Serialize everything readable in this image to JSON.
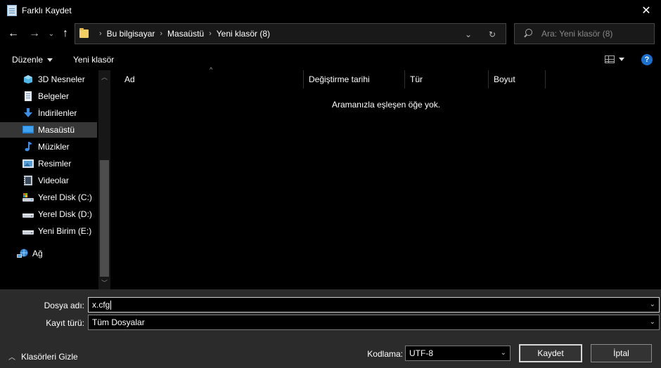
{
  "window": {
    "title": "Farklı Kaydet"
  },
  "nav": {
    "breadcrumbs": [
      "Bu bilgisayar",
      "Masaüstü",
      "Yeni klasör (8)"
    ],
    "search_placeholder": "Ara: Yeni klasör (8)"
  },
  "toolbar": {
    "organize_label": "Düzenle",
    "new_folder_label": "Yeni klasör"
  },
  "sidebar": {
    "items": [
      {
        "label": "3D Nesneler",
        "icon": "3d-objects-icon"
      },
      {
        "label": "Belgeler",
        "icon": "documents-icon"
      },
      {
        "label": "İndirilenler",
        "icon": "downloads-icon"
      },
      {
        "label": "Masaüstü",
        "icon": "desktop-icon",
        "selected": true
      },
      {
        "label": "Müzikler",
        "icon": "music-icon"
      },
      {
        "label": "Resimler",
        "icon": "pictures-icon"
      },
      {
        "label": "Videolar",
        "icon": "videos-icon"
      },
      {
        "label": "Yerel Disk (C:)",
        "icon": "system-drive-icon"
      },
      {
        "label": "Yerel Disk (D:)",
        "icon": "drive-icon"
      },
      {
        "label": "Yeni Birim (E:)",
        "icon": "drive-icon"
      },
      {
        "label": "Ağ",
        "icon": "network-icon"
      }
    ]
  },
  "file_list": {
    "columns": [
      "Ad",
      "Değiştirme tarihi",
      "Tür",
      "Boyut"
    ],
    "empty_message": "Aramanızla eşleşen öğe yok."
  },
  "form": {
    "filename_label": "Dosya adı:",
    "filename_value": "x.cfg",
    "filetype_label": "Kayıt türü:",
    "filetype_value": "Tüm Dosyalar",
    "encoding_label": "Kodlama:",
    "encoding_value": "UTF-8"
  },
  "footer": {
    "hide_folders_label": "Klasörleri Gizle",
    "save_label": "Kaydet",
    "cancel_label": "İptal"
  },
  "colors": {
    "accent": "#1b6fcf",
    "selection": "#363636",
    "panel": "#2b2b2b"
  }
}
